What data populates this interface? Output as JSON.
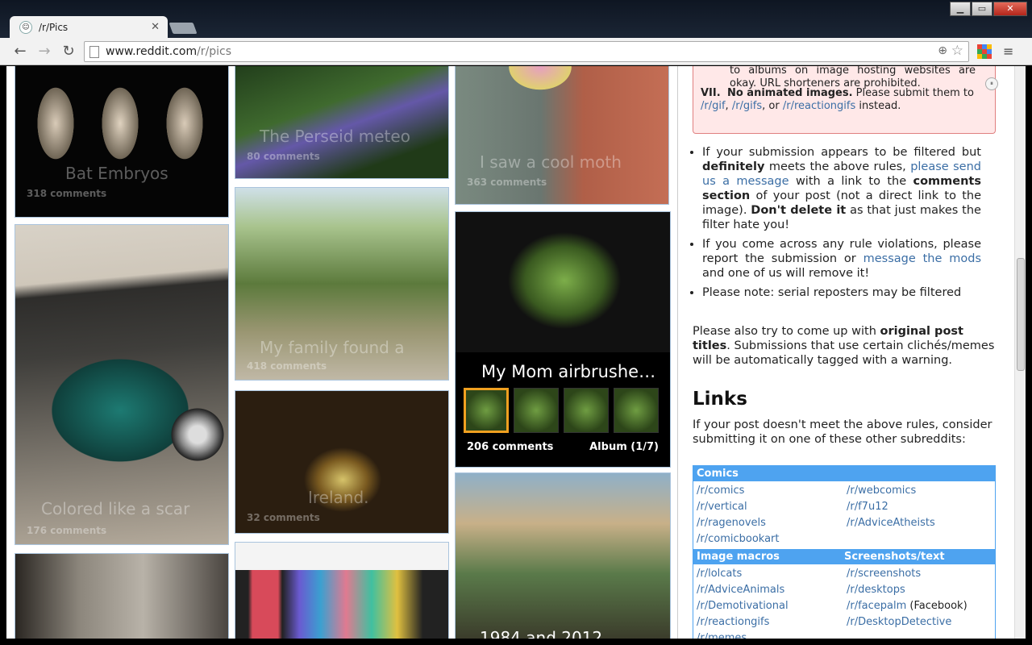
{
  "browser": {
    "tab_title": "/r/Pics",
    "favicon_glyph": "☺",
    "close_glyph": "✕",
    "url_host": "www.reddit.com",
    "url_path": "/r/pics",
    "back_glyph": "←",
    "forward_glyph": "→",
    "reload_glyph": "↻",
    "zoom_glyph": "⊕",
    "star_glyph": "☆",
    "menu_glyph": "≡",
    "window_buttons": {
      "minimize": "▁",
      "maximize": "▭",
      "close": "✕"
    }
  },
  "posts": {
    "col1": [
      {
        "caption": "Bat Embryos",
        "comments": "318 comments"
      },
      {
        "caption": "Colored like a scar",
        "comments": "176 comments"
      },
      {
        "caption": "",
        "comments": ""
      }
    ],
    "col2": [
      {
        "caption": "The Perseid meteo",
        "comments": "80 comments"
      },
      {
        "caption": "My family found a",
        "comments": "418 comments"
      },
      {
        "caption": "Ireland.",
        "comments": "32 comments"
      },
      {
        "caption": "",
        "comments": ""
      }
    ],
    "col3": [
      {
        "caption": "I saw a cool moth",
        "comments": "363 comments"
      },
      {
        "caption": "My Mom airbrushe…",
        "comments": "206 comments",
        "album": "Album (1/7)"
      },
      {
        "caption": "1984 and 2012",
        "comments": ""
      }
    ]
  },
  "sidebar": {
    "rule6_text": "to albums on image hosting websites are okay. URL shorteners are prohibited.",
    "rule7_num": "VII.",
    "rule7_bold": "No animated images.",
    "rule7_text": " Please submit them to ",
    "rule7_links": [
      "/r/gif",
      "/r/gifs",
      "/r/reactiongifs"
    ],
    "rule7_sep1": ", ",
    "rule7_sep2": ", or ",
    "rule7_end": " instead.",
    "bullet1": {
      "a": "If your submission appears to be filtered but ",
      "b": "definitely",
      "c": " meets the above rules, ",
      "link": "please send us a message",
      "d": " with a link to the ",
      "e": "comments section",
      "f": " of your post (not a direct link to the image). ",
      "g": "Don't delete it",
      "h": " as that just makes the filter hate you!"
    },
    "bullet2": {
      "a": "If you come across any rule violations, please report the submission or ",
      "link": "message the mods",
      "b": " and one of us will remove it!"
    },
    "bullet3": "Please note: serial reposters may be filtered",
    "para": {
      "a": "Please also try to come up with ",
      "b": "original post titles",
      "c": ". Submissions that use certain clichés/memes will be automatically tagged with a warning."
    },
    "links_heading": "Links",
    "links_intro": "If your post doesn't meet the above rules, consider submitting it on one of these other subreddits:",
    "comics_header": "Comics",
    "comics_left": [
      "/r/comics",
      "/r/vertical",
      "/r/ragenovels",
      "/r/comicbookart"
    ],
    "comics_right": [
      "/r/webcomics",
      "/r/f7u12",
      "/r/AdviceAtheists"
    ],
    "macros_header": "Image macros",
    "screens_header": "Screenshots/text",
    "macros_left": [
      "/r/lolcats",
      "/r/AdviceAnimals",
      "/r/Demotivational",
      "/r/reactiongifs",
      "/r/memes"
    ],
    "screens_right": [
      "/r/screenshots",
      "/r/desktops",
      "/r/facepalm",
      "/r/DesktopDetective"
    ],
    "facepalm_note": " (Facebook)",
    "pause_glyph": "⏸"
  },
  "colors": {
    "link": "#3b6ea5",
    "table_header": "#4ea3f0",
    "rule_bg": "#ffe8e8",
    "album_thumb_selected": "#f0a020"
  }
}
